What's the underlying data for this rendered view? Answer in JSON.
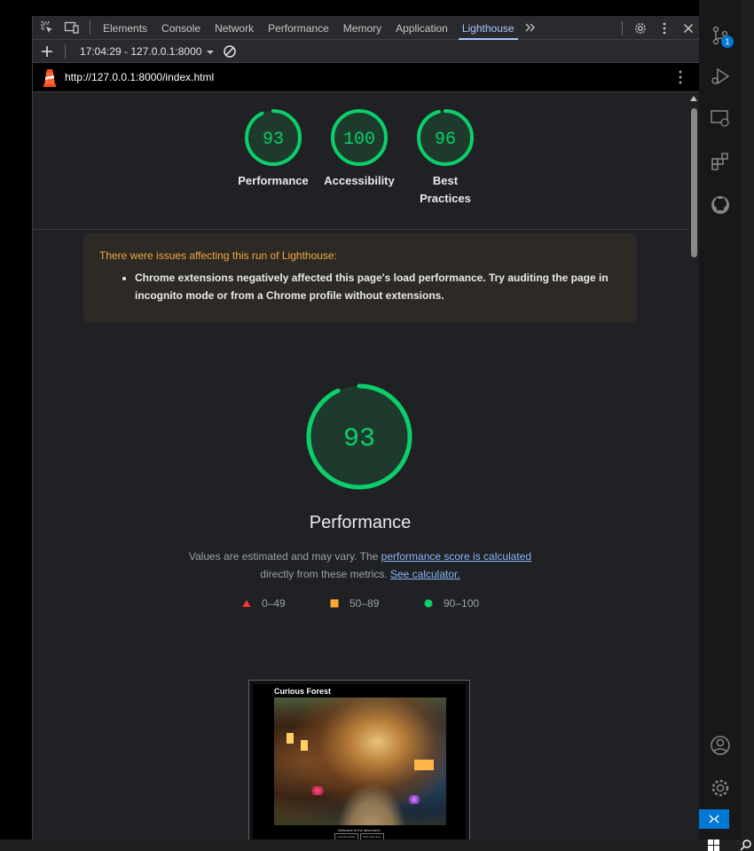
{
  "devtools": {
    "tabs": [
      "Elements",
      "Console",
      "Network",
      "Performance",
      "Memory",
      "Application",
      "Lighthouse"
    ],
    "active_tab": "Lighthouse",
    "report_select": "17:04:29 - 127.0.0.1:8000",
    "url": "http://127.0.0.1:8000/index.html"
  },
  "scores": [
    {
      "label": "Performance",
      "value": "93",
      "fraction": 0.93
    },
    {
      "label": "Accessibility",
      "value": "100",
      "fraction": 1.0
    },
    {
      "label": "Best Practices",
      "value": "96",
      "fraction": 0.96
    }
  ],
  "warning": {
    "title": "There were issues affecting this run of Lighthouse:",
    "item": "Chrome extensions negatively affected this page's load performance. Try auditing the page in incognito mode or from a Chrome profile without extensions."
  },
  "performance": {
    "score": "93",
    "fraction": 0.93,
    "title": "Performance",
    "desc_prefix": "Values are estimated and may vary. The ",
    "desc_link1": "performance score is calculated",
    "desc_middle": " directly from these metrics. ",
    "desc_link2": "See calculator."
  },
  "legend": [
    {
      "label": "0–49",
      "shape": "triangle",
      "color": "#ff3333"
    },
    {
      "label": "50–89",
      "shape": "square",
      "color": "#ffaa33"
    },
    {
      "label": "90–100",
      "shape": "circle",
      "color": "#0cce6b"
    }
  ],
  "screenshot": {
    "title": "Curious Forest",
    "welcome": "Welcome to the adventure!",
    "buttons": [
      "Load Emulation",
      "Start Adventure"
    ]
  },
  "colors": {
    "pass": "#0cce6b",
    "pass_bg": "#1e3a2c",
    "accent": "#a8c7fa",
    "warning": "#f0a742"
  },
  "vscode": {
    "badge": "1"
  }
}
